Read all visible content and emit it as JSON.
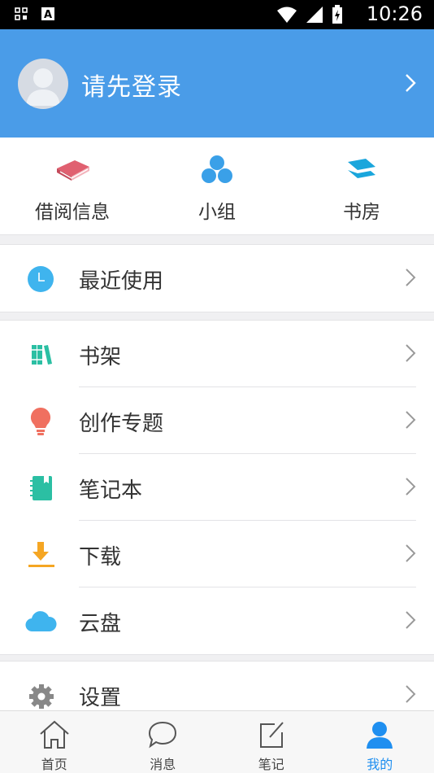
{
  "status_bar": {
    "time": "10:26",
    "left_icons": [
      "grid-icon",
      "a-icon"
    ],
    "right_icons": [
      "wifi-icon",
      "signal-icon",
      "battery-icon"
    ]
  },
  "header": {
    "login_text": "请先登录",
    "bg_color": "#4a9ce8"
  },
  "quick_actions": [
    {
      "label": "借阅信息",
      "icon": "book-icon",
      "color": "#e06070"
    },
    {
      "label": "小组",
      "icon": "group-icon",
      "color": "#3aa0e8"
    },
    {
      "label": "书房",
      "icon": "layers-icon",
      "color": "#1aa6dc"
    }
  ],
  "section1": [
    {
      "label": "最近使用",
      "icon": "clock-icon",
      "color": "#3fb4ee"
    }
  ],
  "section2": [
    {
      "label": "书架",
      "icon": "bookshelf-icon",
      "color": "#2bbfa3"
    },
    {
      "label": "创作专题",
      "icon": "lightbulb-icon",
      "color": "#f07060"
    },
    {
      "label": "笔记本",
      "icon": "notebook-icon",
      "color": "#2bbfa3"
    },
    {
      "label": "下载",
      "icon": "download-icon",
      "color": "#f5a623"
    },
    {
      "label": "云盘",
      "icon": "cloud-icon",
      "color": "#3fb4ee"
    }
  ],
  "section3": [
    {
      "label": "设置",
      "icon": "gear-icon",
      "color": "#888888"
    }
  ],
  "tabs": [
    {
      "label": "首页",
      "icon": "home-icon",
      "active": false
    },
    {
      "label": "消息",
      "icon": "message-icon",
      "active": false
    },
    {
      "label": "笔记",
      "icon": "note-icon",
      "active": false
    },
    {
      "label": "我的",
      "icon": "user-icon",
      "active": true
    }
  ],
  "colors": {
    "accent": "#1f8ff0",
    "header": "#4a9ce8"
  }
}
